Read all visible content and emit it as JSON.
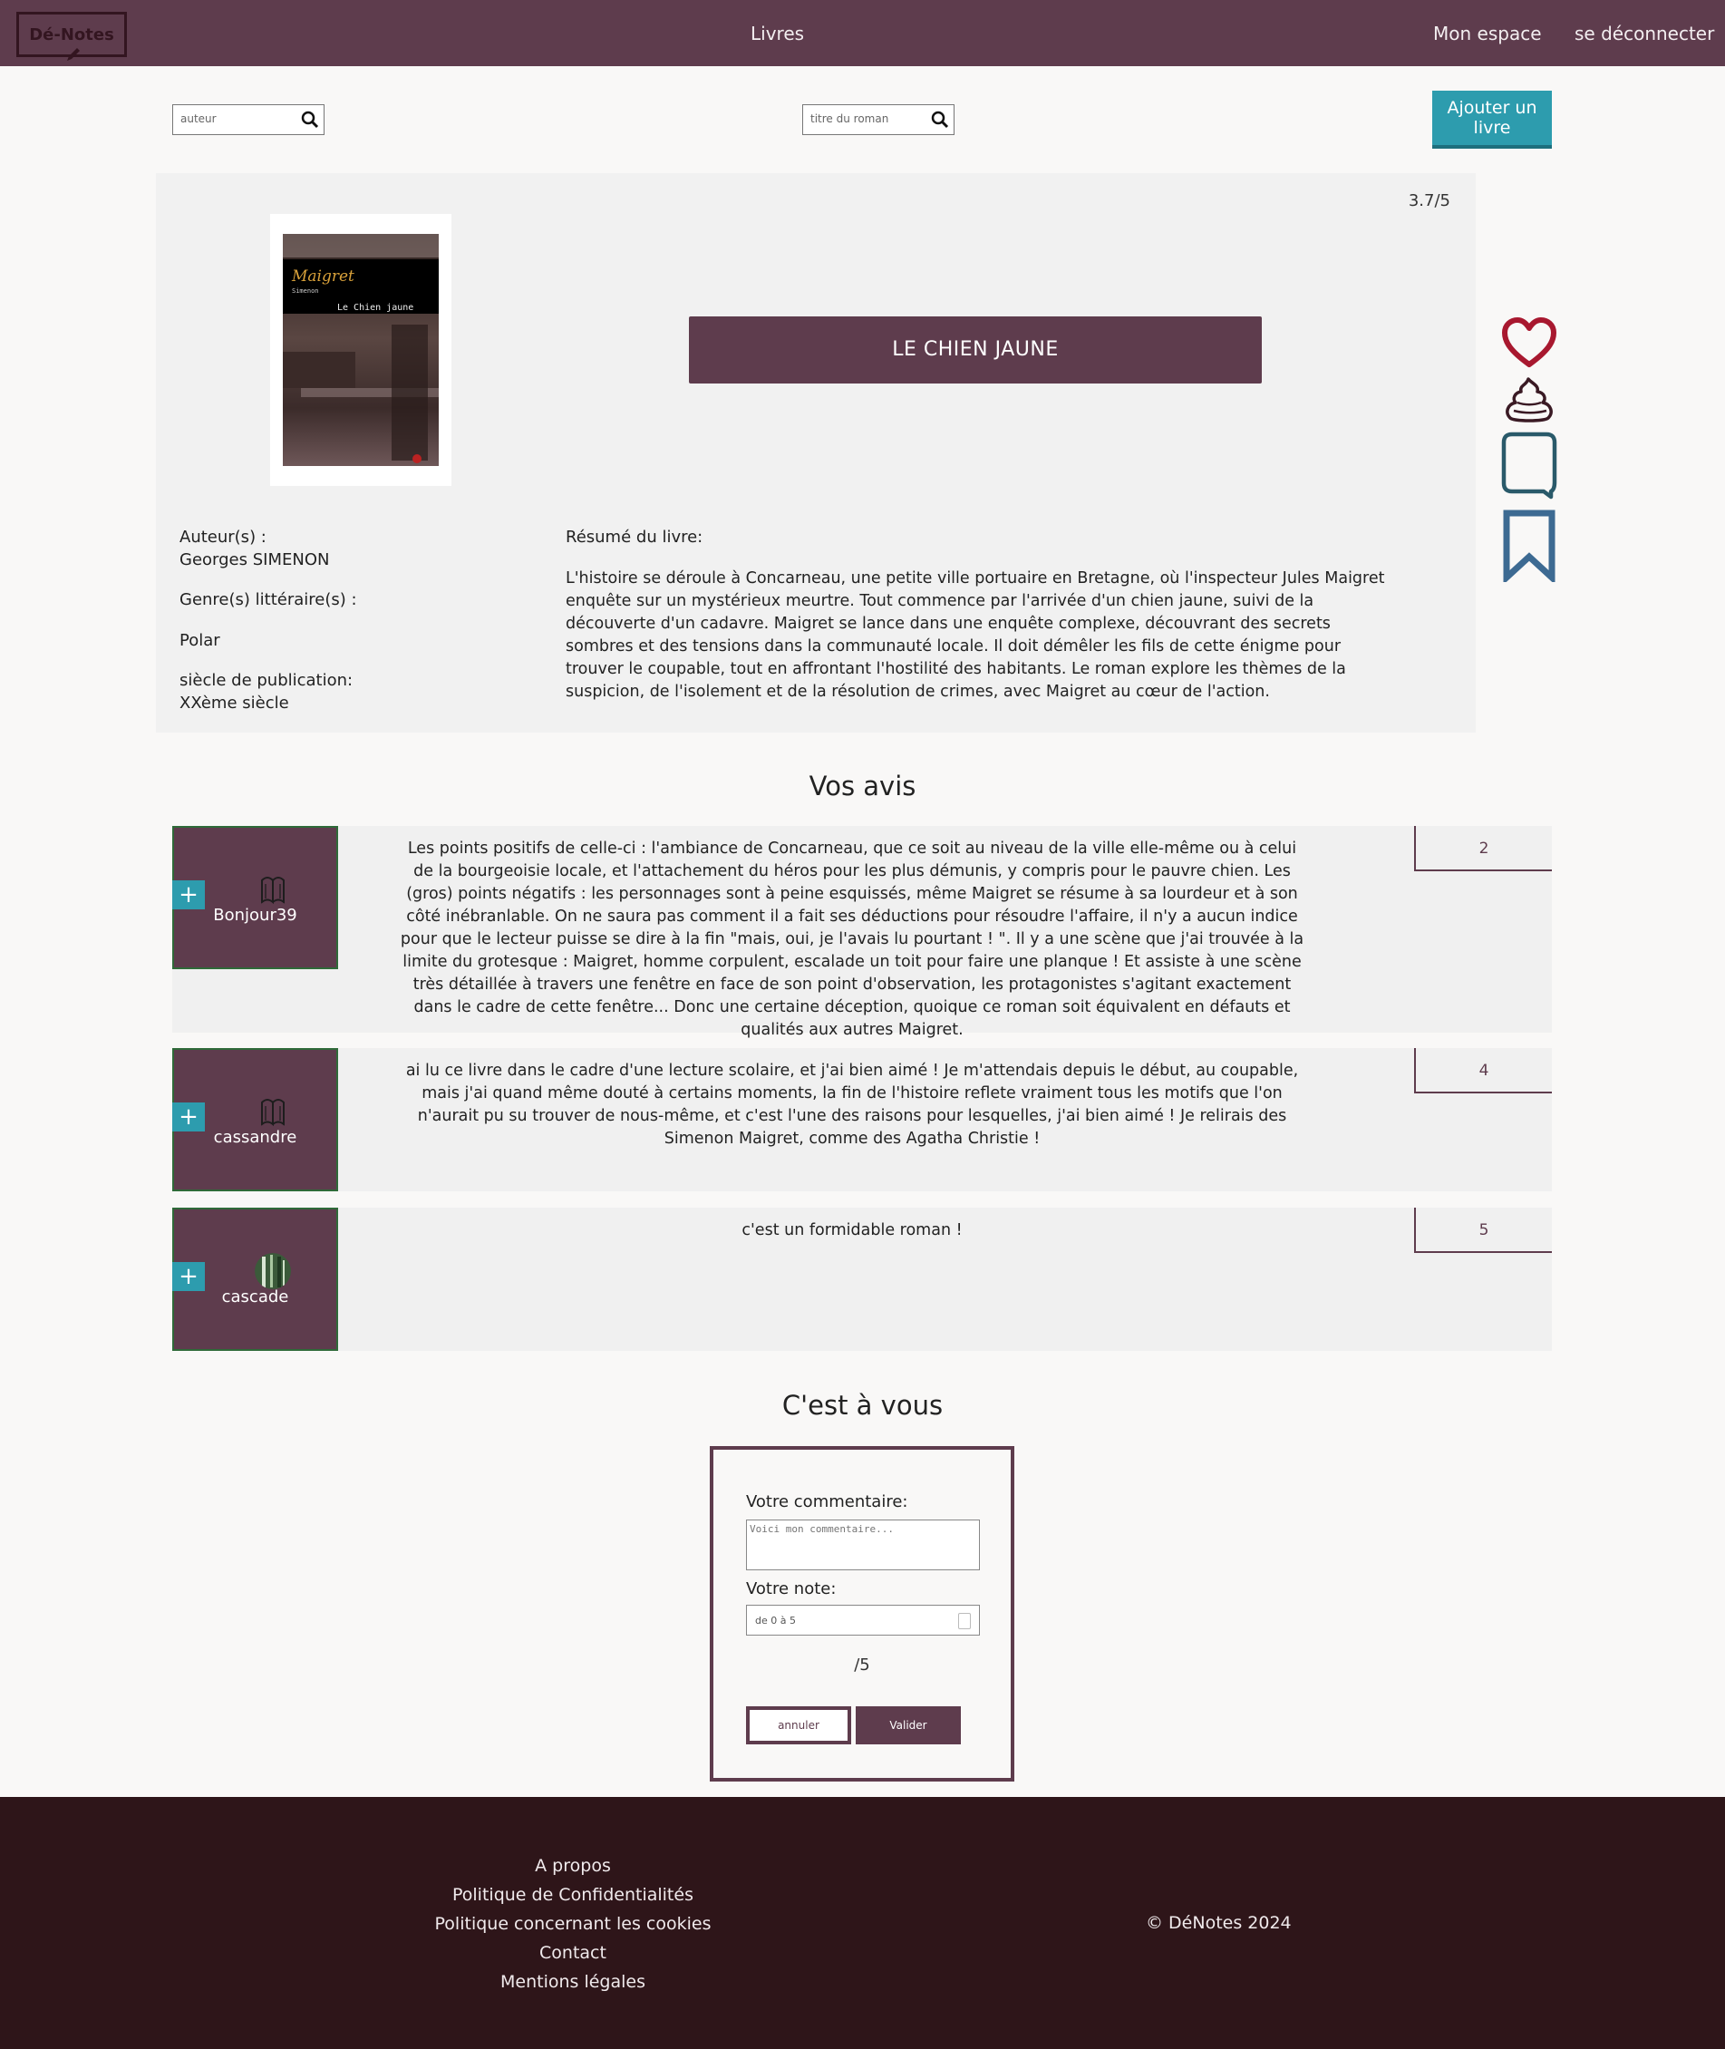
{
  "nav": {
    "logo": "Dé-Notes",
    "books": "Livres",
    "my_space": "Mon espace",
    "logout": "se déconnecter"
  },
  "search": {
    "author_placeholder": "auteur",
    "title_placeholder": "titre du roman"
  },
  "add_book": "Ajouter un livre",
  "book": {
    "rating": "3.7/5",
    "title": "LE CHIEN JAUNE",
    "cover": {
      "series": "Maigret",
      "author": "Simenon",
      "subtitle": "Le Chien jaune"
    },
    "authors_label": "Auteur(s) :",
    "authors": "Georges SIMENON",
    "genre_label": "Genre(s) littéraire(s) :",
    "genre": "Polar",
    "century_label": "siècle de publication:",
    "century": "XXème siècle",
    "resume_label": "Résumé du livre:",
    "resume": "L'histoire se déroule à Concarneau, une petite ville portuaire en Bretagne, où l'inspecteur Jules Maigret enquête sur un mystérieux meurtre. Tout commence par l'arrivée d'un chien jaune, suivi de la découverte d'un cadavre. Maigret se lance dans une enquête complexe, découvrant des secrets sombres et des tensions dans la communauté locale. Il doit démêler les fils de cette énigme pour trouver le coupable, tout en affrontant l'hostilité des habitants. Le roman explore les thèmes de la suspicion, de l'isolement et de la résolution de crimes, avec Maigret au cœur de l'action."
  },
  "actions": {
    "colors": {
      "heart": "#a8182f",
      "poop": "#3a1a24",
      "bubble": "#2a5a6a",
      "bookmark": "#3d6a92"
    }
  },
  "reviews_title": "Vos avis",
  "reviews": [
    {
      "user": "Bonjour39",
      "note": "2",
      "text": "Les points positifs de celle-ci : l'ambiance de Concarneau, que ce soit au niveau de la ville elle-même ou à celui de la bourgeoisie locale, et l'attachement du héros pour les plus démunis, y compris pour le pauvre chien. Les (gros) points négatifs : les personnages sont à peine esquissés, même Maigret se résume à sa lourdeur et à son côté inébranlable. On ne saura pas comment il a fait ses déductions pour résoudre l'affaire, il n'y a aucun indice pour que le lecteur puisse se dire à la fin \"mais, oui, je l'avais lu pourtant ! \". Il y a une scène que j'ai trouvée à la limite du grotesque : Maigret, homme corpulent, escalade un toit pour faire une planque ! Et assiste à une scène très détaillée à travers une fenêtre en face de son point d'observation, les protagonistes s'agitant exactement dans le cadre de cette fenêtre... Donc une certaine déception, quoique ce roman soit équivalent en défauts et qualités aux autres Maigret."
    },
    {
      "user": "cassandre",
      "note": "4",
      "text": "ai lu ce livre dans le cadre d'une lecture scolaire, et j'ai bien aimé ! Je m'attendais depuis le début, au coupable, mais j'ai quand même douté à certains moments, la fin de l'histoire reflete vraiment tous les motifs que l'on n'aurait pu su trouver de nous-même, et c'est l'une des raisons pour lesquelles, j'ai bien aimé ! Je relirais des Simenon Maigret, comme des Agatha Christie !"
    },
    {
      "user": "cascade",
      "note": "5",
      "text": "c'est un formidable roman !"
    }
  ],
  "form": {
    "title": "C'est à vous",
    "comment_label": "Votre commentaire:",
    "comment_placeholder": "Voici mon commentaire...",
    "note_label": "Votre note:",
    "note_placeholder": "de 0 à 5",
    "scale": "/5",
    "cancel": "annuler",
    "submit": "Valider"
  },
  "footer": {
    "links": [
      "A propos",
      "Politique de Confidentialités",
      "Politique concernant les cookies",
      "Contact",
      "Mentions légales"
    ],
    "copyright": "© DéNotes 2024"
  },
  "colors": {
    "primary": "#5e3c4d",
    "accent": "#2d9cae",
    "footer": "#2e1519",
    "background": "#f9f8f7"
  }
}
